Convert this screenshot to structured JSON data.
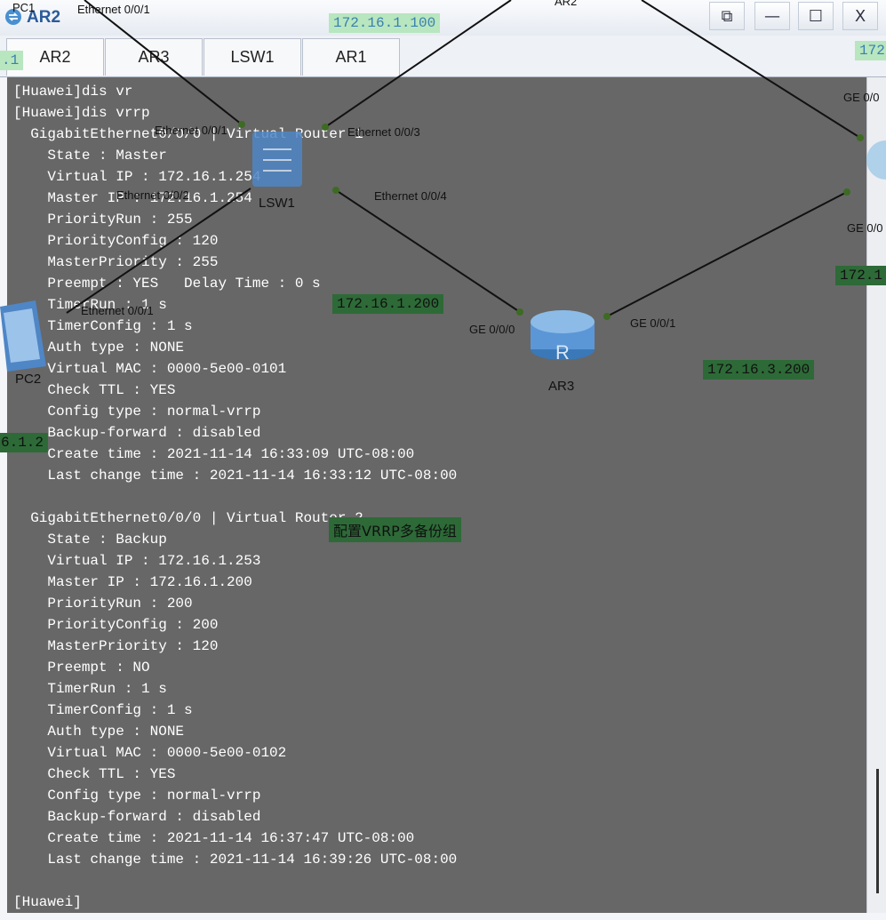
{
  "window": {
    "title": "AR2",
    "buttons": {
      "restore": "⧉",
      "minimize": "—",
      "maximize": "☐",
      "close": "X"
    }
  },
  "tabs": [
    "AR2",
    "AR3",
    "LSW1",
    "AR1"
  ],
  "terminal": {
    "lines": [
      "[Huawei]dis vr",
      "[Huawei]dis vrrp",
      "  GigabitEthernet0/0/0 | Virtual Router 1",
      "    State : Master",
      "    Virtual IP : 172.16.1.254",
      "    Master IP : 172.16.1.254",
      "    PriorityRun : 255",
      "    PriorityConfig : 120",
      "    MasterPriority : 255",
      "    Preempt : YES   Delay Time : 0 s",
      "    TimerRun : 1 s",
      "    TimerConfig : 1 s",
      "    Auth type : NONE",
      "    Virtual MAC : 0000-5e00-0101",
      "    Check TTL : YES",
      "    Config type : normal-vrrp",
      "    Backup-forward : disabled",
      "    Create time : 2021-11-14 16:33:09 UTC-08:00",
      "    Last change time : 2021-11-14 16:33:12 UTC-08:00",
      "",
      "  GigabitEthernet0/0/0 | Virtual Router 2",
      "    State : Backup",
      "    Virtual IP : 172.16.1.253",
      "    Master IP : 172.16.1.200",
      "    PriorityRun : 200",
      "    PriorityConfig : 200",
      "    MasterPriority : 120",
      "    Preempt : NO",
      "    TimerRun : 1 s",
      "    TimerConfig : 1 s",
      "    Auth type : NONE",
      "    Virtual MAC : 0000-5e00-0102",
      "    Check TTL : YES",
      "    Config type : normal-vrrp",
      "    Backup-forward : disabled",
      "    Create time : 2021-11-14 16:37:47 UTC-08:00",
      "    Last change time : 2021-11-14 16:39:26 UTC-08:00",
      "",
      "[Huawei]"
    ]
  },
  "topology": {
    "labels": {
      "pc1": "PC1",
      "pc1_port": "Ethernet 0/0/1",
      "ar2_top": "AR2",
      "lsw1": "LSW1",
      "lsw1_e001": "Ethernet 0/0/1",
      "lsw1_e002": "Ethernet 0/0/2",
      "lsw1_e003": "Ethernet 0/0/3",
      "lsw1_e004": "Ethernet 0/0/4",
      "pc2": "PC2",
      "pc2_port": "Ethernet 0/0/1",
      "ar3": "AR3",
      "ar3_ge000": "GE 0/0/0",
      "ar3_ge001": "GE 0/0/1",
      "ar1_ge_top": "GE 0/0",
      "ar1_ge_bottom": "GE 0/0"
    },
    "ips": {
      "top": "172.16.1.100",
      "right_top": "172",
      "left_edge": ".1",
      "mid": "172.16.1.200",
      "right_mid": "172.1",
      "ar3_link": "172.16.3.200",
      "pc2_left": "6.1.2"
    },
    "annotation": "配置VRRP多备份组"
  },
  "colors": {
    "terminal_bg": "#676767",
    "terminal_fg": "#ffffff",
    "ip_dark": "#2d6a37",
    "ip_light": "#b8e6bf"
  }
}
